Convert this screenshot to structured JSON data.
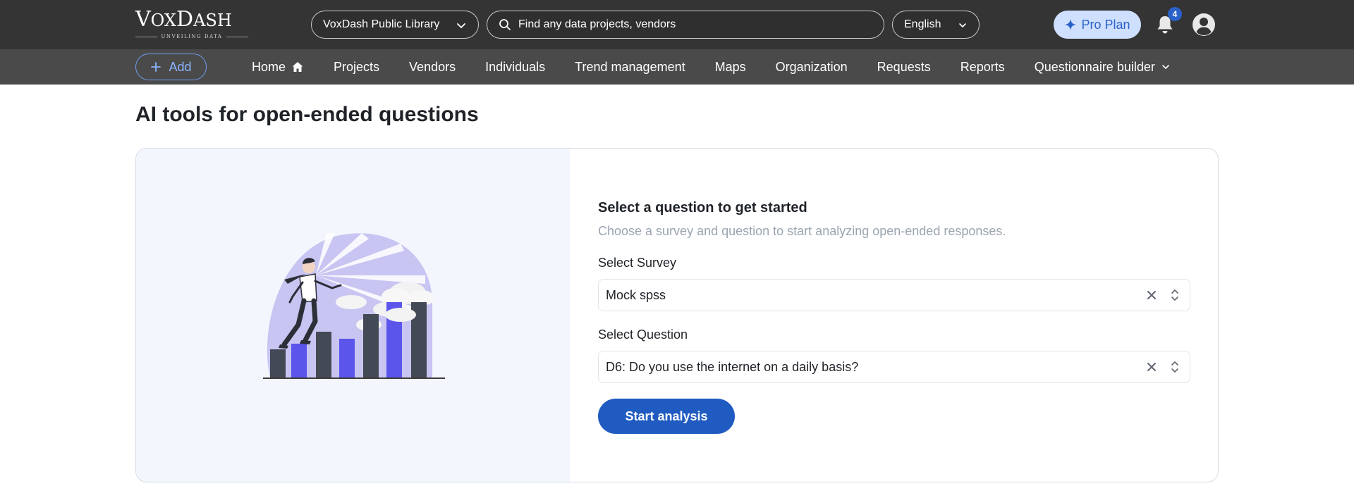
{
  "brand": {
    "name": "VoxDash",
    "tagline": "UNVEILING DATA"
  },
  "header": {
    "library_select": "VoxDash Public Library",
    "search_placeholder": "Find any data projects, vendors",
    "language": "English",
    "pro_label": "Pro Plan",
    "notification_count": "4"
  },
  "nav": {
    "add_label": "Add",
    "items": [
      "Home",
      "Projects",
      "Vendors",
      "Individuals",
      "Trend management",
      "Maps",
      "Organization",
      "Requests",
      "Reports",
      "Questionnaire builder"
    ]
  },
  "page": {
    "title": "AI tools for open-ended questions",
    "card": {
      "heading": "Select a question to get started",
      "subtitle": "Choose a survey and question to start analyzing open-ended responses.",
      "survey_label": "Select Survey",
      "survey_value": "Mock spss",
      "question_label": "Select Question",
      "question_value": "D6: Do you use the internet on a daily basis?",
      "start_button": "Start analysis"
    }
  },
  "colors": {
    "accent": "#1f5bc0",
    "topbar": "#343434",
    "navbar": "#4a4a4a",
    "pro_bg": "#cfe0ff"
  }
}
